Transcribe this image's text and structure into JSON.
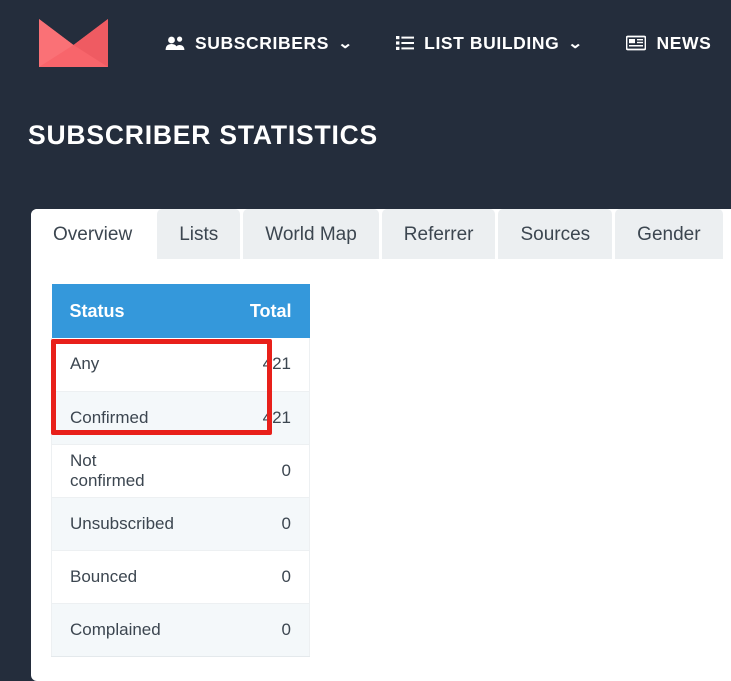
{
  "theme": {
    "header_bg": "#242d3c",
    "accent_blue": "#3498db",
    "logo_color": "#f8656b",
    "annotation_red": "#e8201a",
    "card_bg": "#ffffff",
    "tab_inactive_bg": "#eceff1"
  },
  "topbar": {
    "logo_name": "envelope-logo",
    "nav": [
      {
        "label": "SUBSCRIBERS",
        "icon": "users-icon",
        "caret": "⌄",
        "has_caret": true
      },
      {
        "label": "LIST BUILDING",
        "icon": "list-icon",
        "caret": "⌄",
        "has_caret": true
      },
      {
        "label": "NEWS",
        "icon": "newspaper-icon",
        "caret": "",
        "has_caret": false
      }
    ]
  },
  "header": {
    "title": "SUBSCRIBER STATISTICS"
  },
  "tabs": [
    {
      "label": "Overview",
      "active": true
    },
    {
      "label": "Lists",
      "active": false
    },
    {
      "label": "World Map",
      "active": false
    },
    {
      "label": "Referrer",
      "active": false
    },
    {
      "label": "Sources",
      "active": false
    },
    {
      "label": "Gender",
      "active": false
    }
  ],
  "stats_table": {
    "columns": [
      "Status",
      "Total"
    ],
    "rows": [
      {
        "status": "Any",
        "total": "421",
        "striped": false,
        "highlighted": true
      },
      {
        "status": "Confirmed",
        "total": "421",
        "striped": true,
        "highlighted": true
      },
      {
        "status": "Not confirmed",
        "total": "0",
        "striped": false,
        "highlighted": false
      },
      {
        "status": "Unsubscribed",
        "total": "0",
        "striped": true,
        "highlighted": false
      },
      {
        "status": "Bounced",
        "total": "0",
        "striped": false,
        "highlighted": false
      },
      {
        "status": "Complained",
        "total": "0",
        "striped": true,
        "highlighted": false
      }
    ]
  },
  "annotation": {
    "name": "red-highlight-box",
    "covers": [
      "Any",
      "Confirmed"
    ]
  }
}
